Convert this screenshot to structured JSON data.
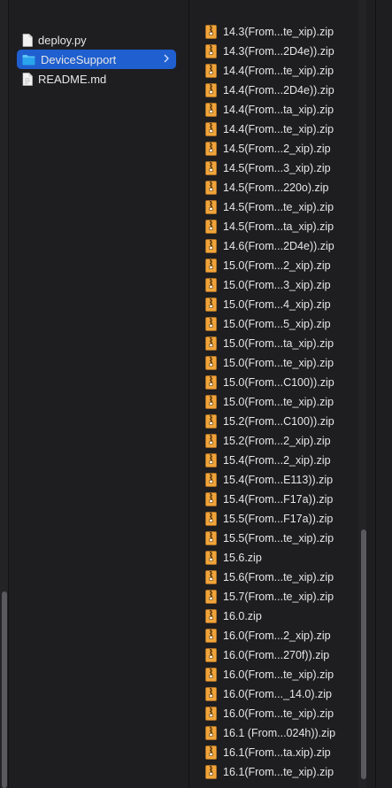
{
  "toolbar": {
    "icons": [
      "icon-view-icon",
      "list-view-icon",
      "column-view-icon",
      "gallery-view-icon"
    ],
    "active_view": "columns"
  },
  "sidebar_column": {
    "items": [
      {
        "label": "deploy.py",
        "icon": "document-icon",
        "selected": false
      },
      {
        "label": "DeviceSupport",
        "icon": "folder-icon",
        "selected": true
      },
      {
        "label": "README.md",
        "icon": "document-icon",
        "selected": false
      }
    ]
  },
  "files_column": {
    "items": [
      "14.3(From...te_xip).zip",
      "14.3(From...2D4e)).zip",
      "14.4(From...te_xip).zip",
      "14.4(From...2D4e)).zip",
      "14.4(From...ta_xip).zip",
      "14.4(From...te_xip).zip",
      "14.5(From...2_xip).zip",
      "14.5(From...3_xip).zip",
      "14.5(From...220o).zip",
      "14.5(From...te_xip).zip",
      "14.5(From...ta_xip).zip",
      "14.6(From...2D4e)).zip",
      "15.0(From...2_xip).zip",
      "15.0(From...3_xip).zip",
      "15.0(From...4_xip).zip",
      "15.0(From...5_xip).zip",
      "15.0(From...ta_xip).zip",
      "15.0(From...te_xip).zip",
      "15.0(From...C100)).zip",
      "15.0(From...te_xip).zip",
      "15.2(From...C100)).zip",
      "15.2(From...2_xip).zip",
      "15.4(From...2_xip).zip",
      "15.4(From...E113)).zip",
      "15.4(From...F17a)).zip",
      "15.5(From...F17a)).zip",
      "15.5(From...te_xip).zip",
      "15.6.zip",
      "15.6(From...te_xip).zip",
      "15.7(From...te_xip).zip",
      "16.0.zip",
      "16.0(From...2_xip).zip",
      "16.0(From...270f)).zip",
      "16.0(From...te_xip).zip",
      "16.0(From..._14.0).zip",
      "16.0(From...te_xip).zip",
      "16.1 (From...024h)).zip",
      "16.1(From...ta.xip).zip",
      "16.1(From...te_xip).zip"
    ]
  },
  "colors": {
    "background": "#1e1e21",
    "selection": "#1f5fcf",
    "text": "#e6e6e6",
    "zip_icon": "#f0a43a"
  }
}
